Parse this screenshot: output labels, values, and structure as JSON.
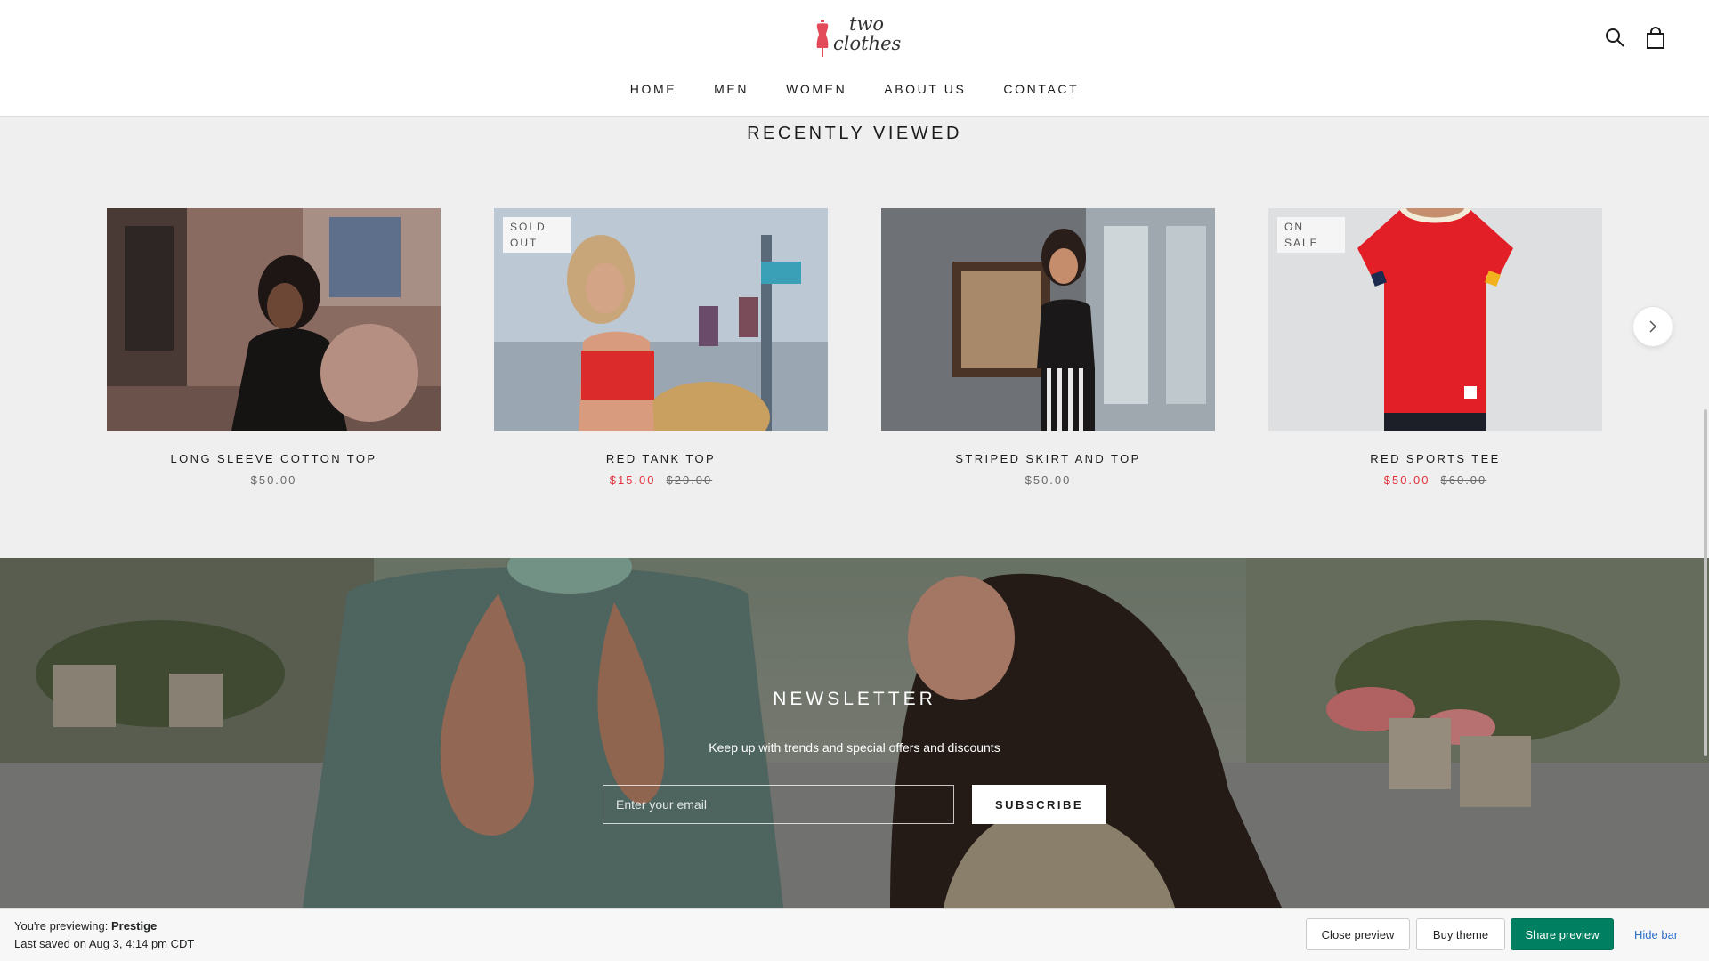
{
  "header": {
    "logo": {
      "line1": "two",
      "line2": "clothes"
    },
    "nav": [
      "HOME",
      "MEN",
      "WOMEN",
      "ABOUT US",
      "CONTACT"
    ],
    "icons": [
      "search-icon",
      "shopping-bag-icon"
    ]
  },
  "recently_viewed": {
    "title": "RECENTLY VIEWED",
    "products": [
      {
        "name": "LONG SLEEVE COTTON TOP",
        "price": "$50.00",
        "sale_price": "",
        "compare_price": "",
        "badge": ""
      },
      {
        "name": "RED TANK TOP",
        "price": "",
        "sale_price": "$15.00",
        "compare_price": "$20.00",
        "badge": "SOLD OUT"
      },
      {
        "name": "STRIPED SKIRT AND TOP",
        "price": "$50.00",
        "sale_price": "",
        "compare_price": "",
        "badge": ""
      },
      {
        "name": "RED SPORTS TEE",
        "price": "",
        "sale_price": "$50.00",
        "compare_price": "$60.00",
        "badge": "ON SALE"
      }
    ],
    "next_icon": "chevron-right-icon"
  },
  "newsletter": {
    "title": "NEWSLETTER",
    "subtitle": "Keep up with trends and special offers and discounts",
    "email_placeholder": "Enter your email",
    "subscribe_label": "SUBSCRIBE"
  },
  "preview_bar": {
    "previewing_prefix": "You're previewing:",
    "theme_name": "Prestige",
    "last_saved": "Last saved on Aug 3, 4:14 pm CDT",
    "close_label": "Close preview",
    "buy_label": "Buy theme",
    "share_label": "Share preview",
    "hide_label": "Hide bar"
  },
  "colors": {
    "accent_sale": "#e2323d",
    "shopify_green": "#008060",
    "link_blue": "#2c6ecb",
    "section_bg": "#efefef"
  }
}
